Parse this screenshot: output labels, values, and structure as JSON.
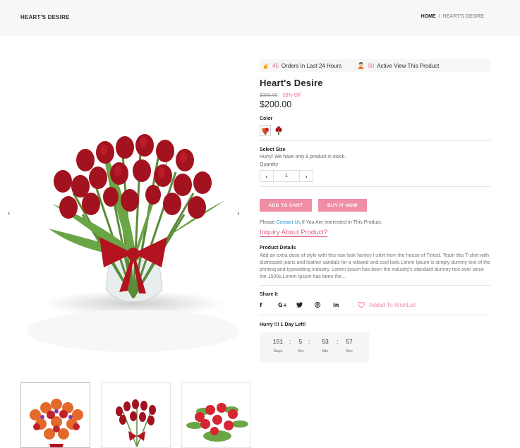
{
  "header": {
    "brand": "HEART'S DESIRE",
    "breadcrumb": {
      "home": "HOME",
      "separator": "/",
      "current": "HEART'S DESIRE"
    }
  },
  "stats": {
    "orders_count": "45",
    "orders_label": "Orders In Last 24 Hours",
    "active_count": "90",
    "active_label": "Active View This Product"
  },
  "product": {
    "title": "Heart's Desire",
    "old_price": "$300.00",
    "discount": "-33% Off",
    "price": "$200.00",
    "color_label": "Color",
    "size_label": "Select Size",
    "stock_text": "Hurry! We have only 8 product in stock.",
    "quantity_label": "Quantity",
    "quantity_value": "1",
    "add_to_cart": "ADD TO CART",
    "buy_it_now": "BUY IT NOW",
    "contact_prefix": "Please ",
    "contact_link": "Contact Us",
    "contact_suffix": " If You Are Interested In This Product.",
    "inquiry": "Inquiry About Product?",
    "details_label": "Product Details",
    "details_text": "Add an extra dose of style with this raw look henley t-shirt from the house of Tinted. Team this T-shirt with distressed jeans and leather sandals for a relaxed and cool look.Lorem Ipsum is simply dummy text of the printing and typesetting industry. Lorem Ipsum has been the industry's standard dummy text ever since the 1500s.Lorem Ipsum has been the...",
    "share_label": "Share It",
    "wishlist": "Added To WishList",
    "hurry": "Hurry !!! 1 Day Left!"
  },
  "timer": {
    "days": "151",
    "days_label": "Days",
    "hrs": "5",
    "hrs_label": "Hrs",
    "min": "53",
    "min_label": "Min",
    "sec": "57",
    "sec_label": "Sec"
  },
  "colors": {
    "accent": "#ef6b8a",
    "button": "#f08ea6",
    "link": "#1f93d4",
    "tulip_red": "#a3121f"
  },
  "icons": {
    "orders": "fire-icon",
    "active": "person-icon",
    "prev": "chevron-left-icon",
    "next": "chevron-right-icon",
    "wishlist": "heart-outline-icon"
  }
}
